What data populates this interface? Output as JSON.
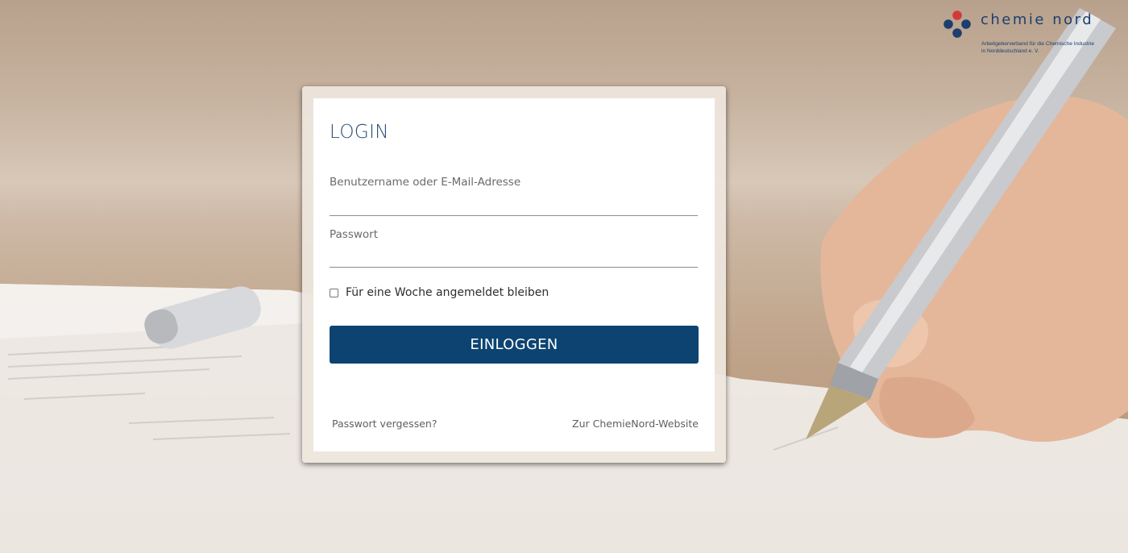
{
  "logo": {
    "wordmark": "chemie nord",
    "subtitle": "Arbeitgeberverband für die Chemische Industrie\nin Norddeutschland e. V.",
    "colors": {
      "red": "#d23a3a",
      "navy": "#1d3f6e"
    }
  },
  "login": {
    "title": "LOGIN",
    "username_label": "Benutzername oder E-Mail-Adresse",
    "username_value": "",
    "password_label": "Passwort",
    "password_value": "",
    "remember_label": "Für eine Woche angemeldet bleiben",
    "remember_checked": false,
    "submit_label": "EINLOGGEN",
    "forgot_link": "Passwort vergessen?",
    "website_link": "Zur ChemieNord-Website"
  },
  "colors": {
    "accent": "#0c4371",
    "title": "#264d74"
  }
}
